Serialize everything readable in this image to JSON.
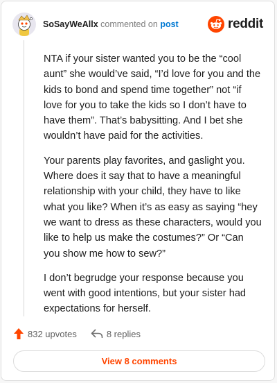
{
  "comment": {
    "username": "SoSayWeAllx",
    "action_text": "commented on",
    "target_text": "post",
    "brand": "reddit",
    "paragraphs": [
      "NTA if your sister wanted you to be the “cool aunt” she would’ve said, “I’d love for you and the kids to bond and spend time together” not “if love for you to take the kids so I don’t have to have them”. That’s babysitting. And I bet she wouldn’t have paid for the activities.",
      "Your parents play favorites, and gaslight you. Where does it say that to have a meaningful relationship with your child, they have to like what you like? When it’s as easy as saying “hey we want to dress as these characters, would you like to help us make the costumes?” Or “Can you show me how to sew?”",
      "I don’t begrudge your response because you went with good intentions, but your sister had expectations for herself."
    ]
  },
  "actions": {
    "upvotes": "832 upvotes",
    "replies": "8 replies"
  },
  "footer": {
    "view_comments": "View 8 comments"
  },
  "colors": {
    "brand": "#ff4500",
    "link": "#0079d3"
  },
  "icons": {
    "avatar": "snoo-avatar-icon",
    "logo": "reddit-logo-icon",
    "upvote": "upvote-arrow-icon",
    "reply": "reply-arrow-icon"
  }
}
